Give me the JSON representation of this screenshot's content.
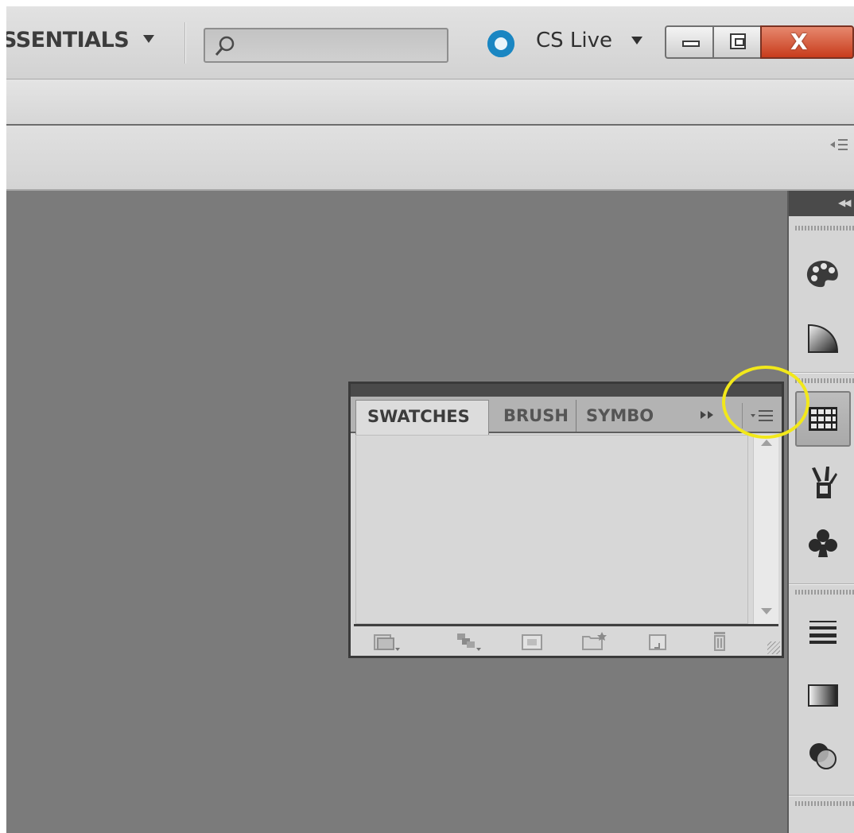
{
  "titlebar": {
    "workspace_label": "SSENTIALS",
    "cs_live_label": "CS Live",
    "window_controls": [
      "minimize",
      "restore",
      "close"
    ]
  },
  "panel": {
    "tabs": [
      {
        "label": "SWATCHES",
        "active": true
      },
      {
        "label": "BRUSH",
        "active": false
      },
      {
        "label": "SYMBO",
        "active": false
      }
    ]
  },
  "dock": {
    "items": [
      "palette-icon",
      "gradient-icon",
      "swatches-icon",
      "brushes-icon",
      "symbols-icon",
      "stroke-icon",
      "gradient-swatch-icon",
      "transparency-icon"
    ],
    "active_item": "swatches-icon"
  },
  "colors": {
    "canvas_gray": "#7b7b7b",
    "chrome_light": "#d6d6d6",
    "close_red": "#c83c1c",
    "cs_live_blue": "#1e8cc6",
    "highlight_yellow": "#f2e81a"
  }
}
